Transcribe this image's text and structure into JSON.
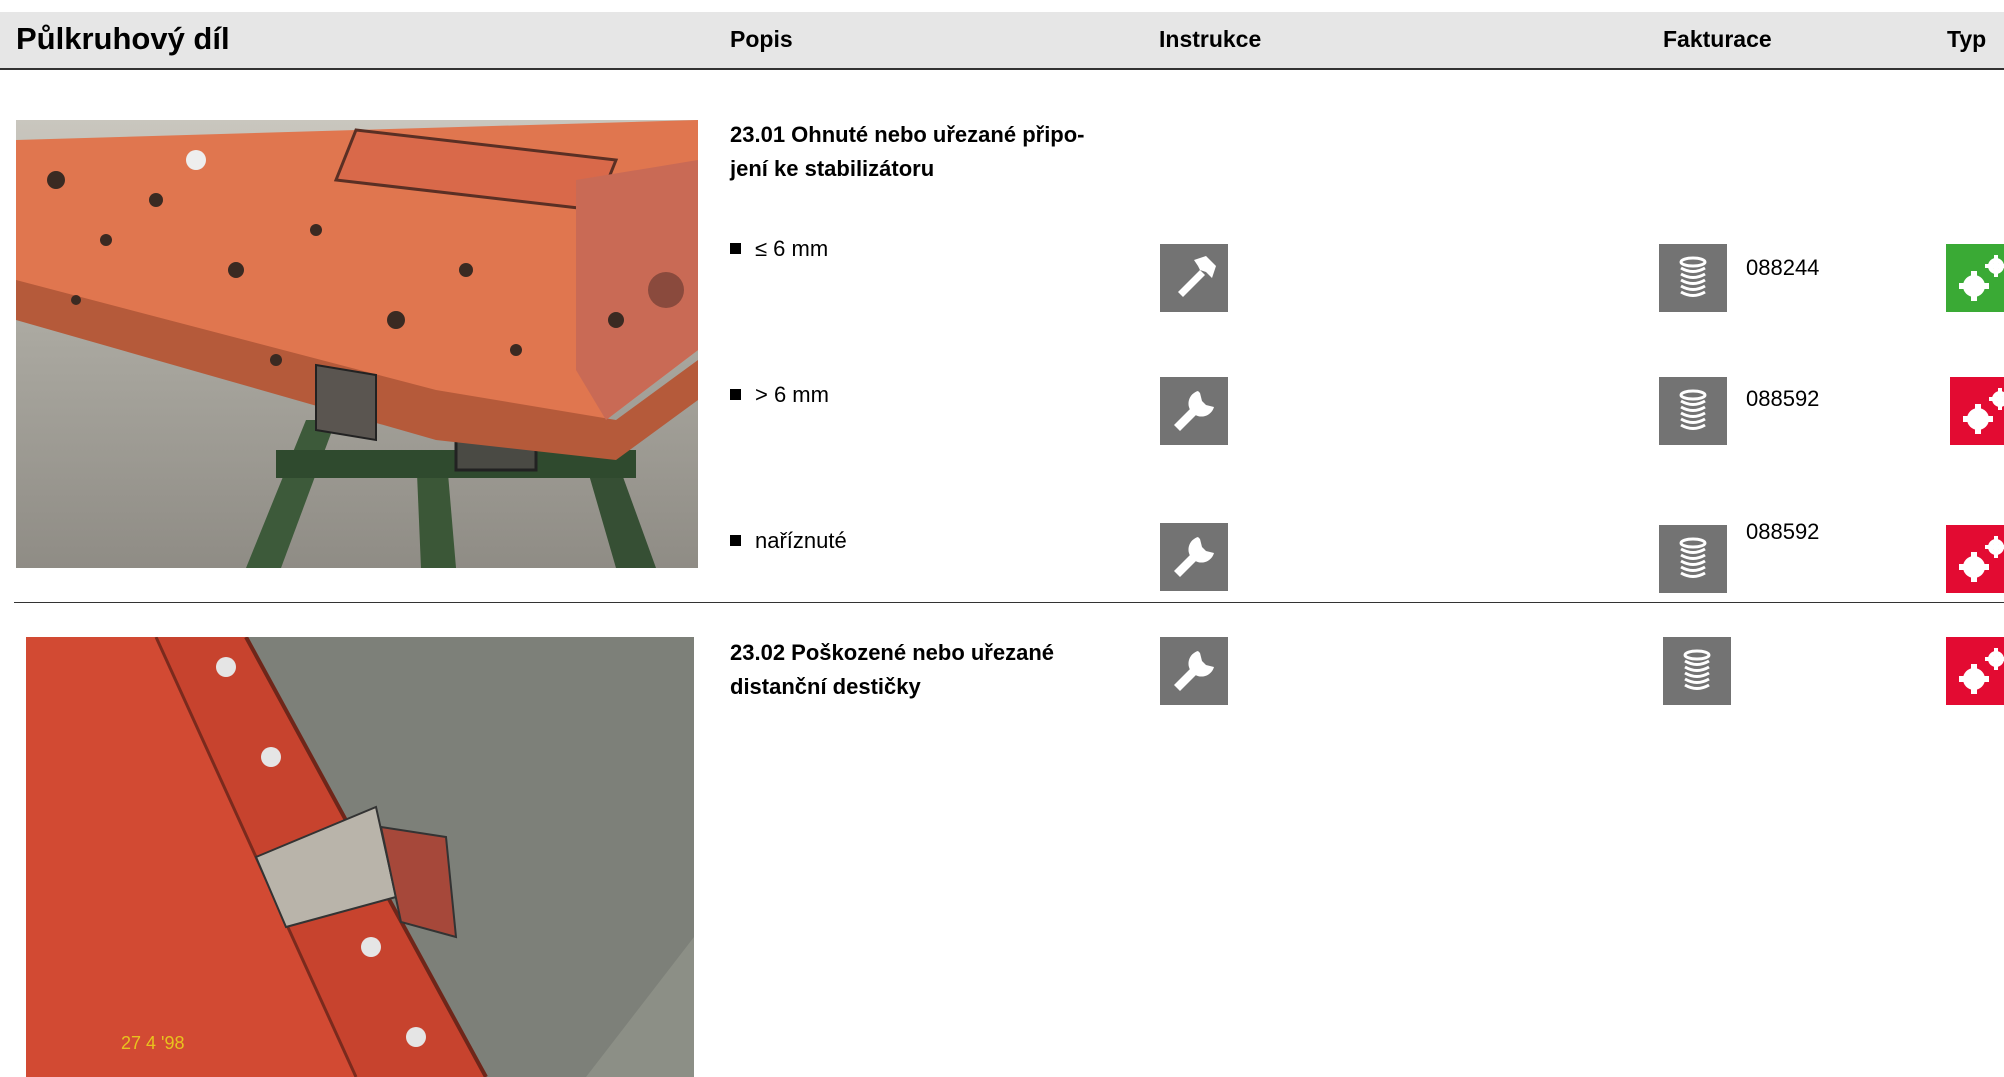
{
  "header": {
    "title": "Půlkruhový díl",
    "col_popis": "Popis",
    "col_instrukce": "Instrukce",
    "col_fakturace": "Fakturace",
    "col_typ": "Typ"
  },
  "sections": [
    {
      "title": "23.01 Ohnuté nebo uřezané připo-jení ke stabilizátoru",
      "title_line1": "23.01 Ohnuté nebo uřezané připo-",
      "title_line2": "jení ke stabilizátoru",
      "photo": "photo of orange semicircular part with bent stabilizer connection",
      "items": [
        {
          "label": "≤ 6 mm",
          "instrukce_icon": "hammer-icon",
          "fakturace_icon": "coin-stack-icon",
          "code": "088244",
          "typ_icon": "gears-icon",
          "typ_color": "#3aaa35"
        },
        {
          "label": "> 6 mm",
          "instrukce_icon": "wrench-icon",
          "fakturace_icon": "coin-stack-icon",
          "code": "088592",
          "typ_icon": "gears-icon",
          "typ_color": "#e30b32"
        },
        {
          "label": "naříznuté",
          "instrukce_icon": "wrench-icon",
          "fakturace_icon": "coin-stack-icon",
          "code": "088592",
          "typ_icon": "gears-icon",
          "typ_color": "#e30b32"
        }
      ]
    },
    {
      "title": "23.02 Poškozené nebo uřezané distanční destičky",
      "title_line1": "23.02 Poškozené nebo uřezané",
      "title_line2": "distanční destičky",
      "photo": "photo of red panel with damaged spacer plate",
      "photo_stamp": "27  4 '98",
      "instrukce_icon": "wrench-icon",
      "fakturace_icon": "coin-stack-icon",
      "typ_icon": "gears-icon",
      "typ_color": "#e30b32"
    }
  ],
  "colors": {
    "header_bg": "#e6e6e6",
    "icon_gray": "#737373",
    "typ_green": "#3aaa35",
    "typ_red": "#e30b32"
  }
}
